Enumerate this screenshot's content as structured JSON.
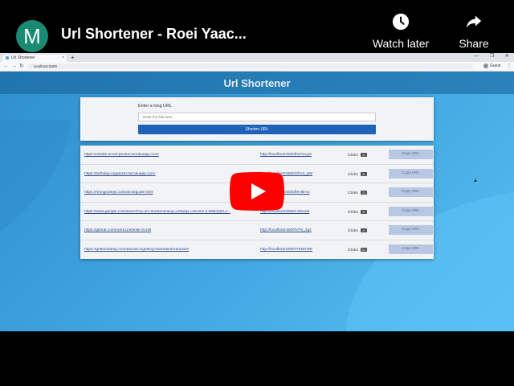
{
  "youtube": {
    "channel_initial": "M",
    "title": "Url Shortener - Roei Yaac...",
    "watch_later_label": "Watch later",
    "share_label": "Share"
  },
  "browser": {
    "tab_title": "Url Shortener",
    "tab_close": "×",
    "new_tab": "+",
    "window_controls": "— ❐ ✕",
    "address": "localhost:5000",
    "profile_label": "Guest",
    "nav_back": "←",
    "nav_forward": "→",
    "nav_reload": "↻",
    "menu": "⋮"
  },
  "app": {
    "title": "Url Shortener",
    "form_label": "Enter a long URL",
    "input_placeholder": "Enter the link here",
    "shorten_button": "Shorten URL",
    "clicks_label": "Clicks",
    "copy_label": "Copy URL",
    "rows": [
      {
        "long": "https://infinite-scroll-photos.herokuapp.com/",
        "short": "http://localhost:5000/hvFKLyD",
        "clicks": "3"
      },
      {
        "long": "https://birthday-organizer.herokuapp.com/",
        "short": "http://localhost:5000/2Fe4_pW",
        "clicks": "6"
      },
      {
        "long": "https://mongoosejs.com/docs/guide.html",
        "short": "http://localhost:5000/lKHB-vx",
        "clicks": "3"
      },
      {
        "long": "https://www.google.com/search?q=url+shortener&oq=url&aqs=chrome.2.69i57j0l3.2...",
        "short": "http://localhost:5000/-3Dv4at",
        "clicks": "8"
      },
      {
        "long": "https://github.com/roei111/infinite-Scroll",
        "short": "http://localhost:5000/VPo_2gs",
        "clicks": "4"
      },
      {
        "long": "https://getbootstrap.com/docs/5.1/getting-started/introduction/",
        "short": "http://localhost:5000/YEDKWE",
        "clicks": "11"
      }
    ]
  },
  "colors": {
    "youtube_red": "#ff0000",
    "button_blue": "#1f62b9",
    "page_blue": "#3fa3de"
  }
}
